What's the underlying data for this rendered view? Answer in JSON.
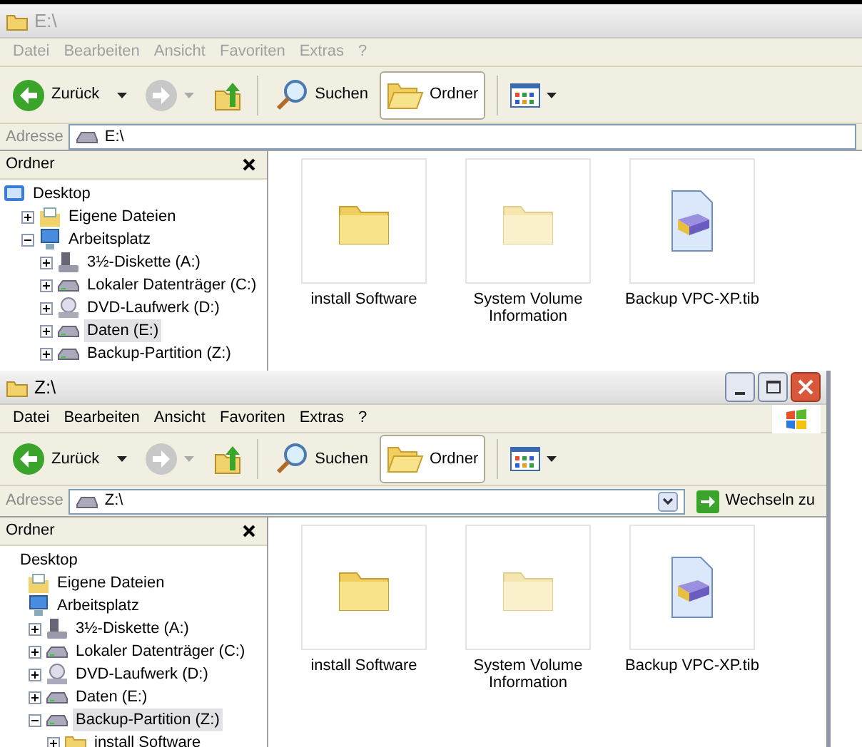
{
  "windows": [
    {
      "title": "E:\\",
      "active": false,
      "menu": [
        "Datei",
        "Bearbeiten",
        "Ansicht",
        "Favoriten",
        "Extras",
        "?"
      ],
      "toolbar": {
        "back": "Zurück",
        "search": "Suchen",
        "folders": {
          "label": "Ordner",
          "selected": true
        }
      },
      "address_label": "Adresse",
      "address": "E:\\",
      "folder_pane_title": "Ordner",
      "tree": [
        {
          "label": "Desktop",
          "kind": "desktop",
          "selected": false,
          "children": [
            {
              "label": "Eigene Dateien",
              "kind": "documents",
              "expanded": false,
              "selected": false
            },
            {
              "label": "Arbeitsplatz",
              "kind": "computer",
              "expanded": true,
              "selected": false,
              "children": [
                {
                  "label": "3½-Diskette (A:)",
                  "kind": "floppy",
                  "expanded": false,
                  "selected": false
                },
                {
                  "label": "Lokaler Datenträger (C:)",
                  "kind": "drive",
                  "expanded": false,
                  "selected": false
                },
                {
                  "label": "DVD-Laufwerk (D:)",
                  "kind": "dvd",
                  "expanded": false,
                  "selected": false
                },
                {
                  "label": "Daten (E:)",
                  "kind": "drive",
                  "expanded": false,
                  "selected": true
                },
                {
                  "label": "Backup-Partition (Z:)",
                  "kind": "drive",
                  "expanded": false,
                  "selected": false
                }
              ]
            }
          ]
        }
      ],
      "items": [
        {
          "label": "install Software",
          "kind": "folder"
        },
        {
          "label": "System Volume Information",
          "kind": "hidden_folder"
        },
        {
          "label": "Backup VPC-XP.tib",
          "kind": "backup_file"
        }
      ]
    },
    {
      "title": "Z:\\",
      "active": true,
      "menu": [
        "Datei",
        "Bearbeiten",
        "Ansicht",
        "Favoriten",
        "Extras",
        "?"
      ],
      "toolbar": {
        "back": "Zurück",
        "search": "Suchen",
        "folders": {
          "label": "Ordner",
          "selected": true
        }
      },
      "address_label": "Adresse",
      "address": "Z:\\",
      "go_button": "Wechseln zu",
      "folder_pane_title": "Ordner",
      "tree": [
        {
          "label": "Desktop",
          "kind": "none",
          "selected": false,
          "children": [
            {
              "label": "Eigene Dateien",
              "kind": "documents",
              "selected": false
            },
            {
              "label": "Arbeitsplatz",
              "kind": "computer",
              "selected": false,
              "children": [
                {
                  "label": "3½-Diskette (A:)",
                  "kind": "floppy",
                  "expanded": false,
                  "selected": false
                },
                {
                  "label": "Lokaler Datenträger (C:)",
                  "kind": "drive",
                  "expanded": false,
                  "selected": false
                },
                {
                  "label": "DVD-Laufwerk (D:)",
                  "kind": "dvd",
                  "expanded": false,
                  "selected": false
                },
                {
                  "label": "Daten (E:)",
                  "kind": "drive",
                  "expanded": false,
                  "selected": false
                },
                {
                  "label": "Backup-Partition (Z:)",
                  "kind": "drive",
                  "expanded": true,
                  "selected": true,
                  "children": [
                    {
                      "label": "install Software",
                      "kind": "folder",
                      "expanded": false,
                      "selected": false
                    }
                  ]
                }
              ]
            }
          ]
        }
      ],
      "items": [
        {
          "label": "install Software",
          "kind": "folder"
        },
        {
          "label": "System Volume Information",
          "kind": "hidden_folder"
        },
        {
          "label": "Backup VPC-XP.tib",
          "kind": "backup_file"
        }
      ]
    }
  ]
}
